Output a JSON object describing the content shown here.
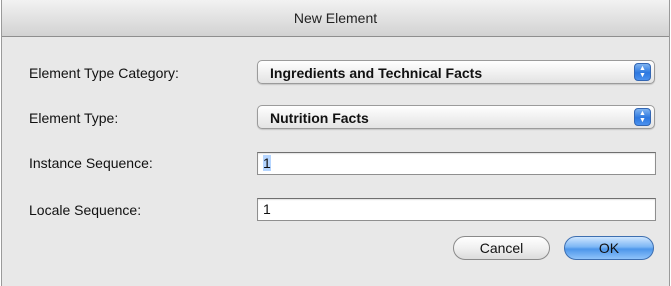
{
  "window": {
    "title": "New Element"
  },
  "form": {
    "element_type_category": {
      "label": "Element Type Category:",
      "value": "Ingredients and Technical Facts"
    },
    "element_type": {
      "label": "Element Type:",
      "value": "Nutrition Facts"
    },
    "instance_sequence": {
      "label": "Instance Sequence:",
      "value": "1"
    },
    "locale_sequence": {
      "label": "Locale Sequence:",
      "value": "1"
    }
  },
  "buttons": {
    "cancel_label": "Cancel",
    "ok_label": "OK"
  },
  "icons": {
    "popup_arrows": "up-down-chevron-icon"
  },
  "colors": {
    "accent": "#2d78e0",
    "selection": "#b5d5ff"
  }
}
